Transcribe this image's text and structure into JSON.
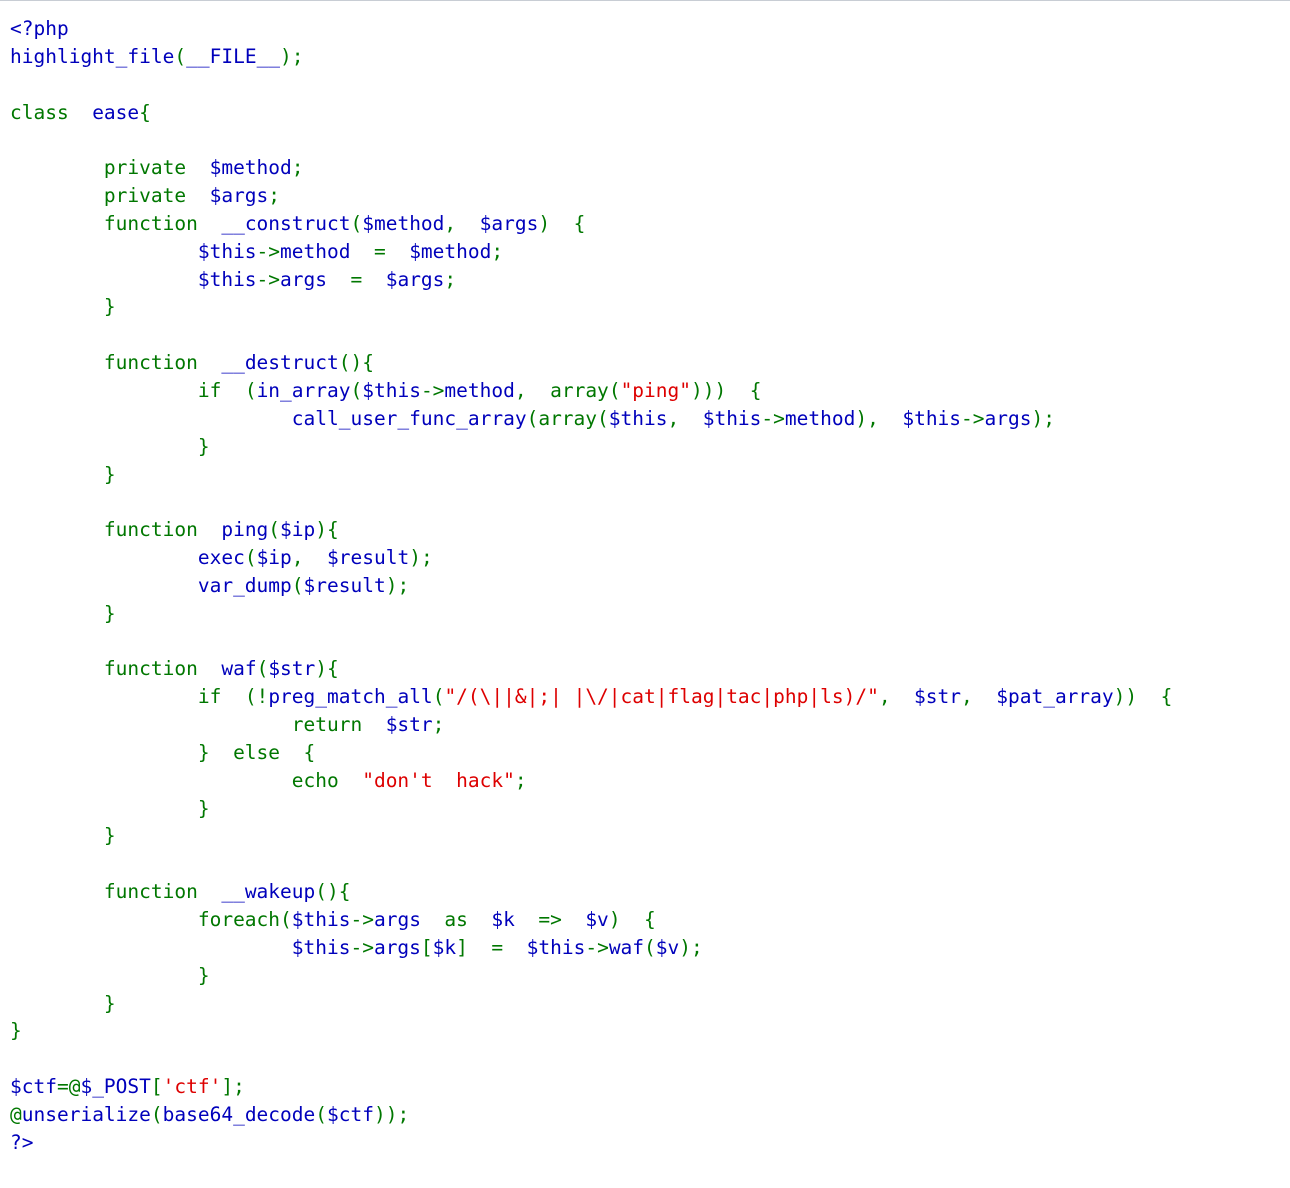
{
  "page": {
    "title": "highlight_file source view",
    "background": "#ffffff",
    "top_rule_color": "#c8cdd4"
  },
  "syntax_colors": {
    "keyword": "#007700",
    "default": "#0000BB",
    "string": "#DD0000",
    "comment": "#FF8000",
    "html": "#000000"
  },
  "code": {
    "language": "php",
    "lines": [
      [
        {
          "t": "<?php",
          "c": "def"
        }
      ],
      [
        {
          "t": "highlight_file",
          "c": "def"
        },
        {
          "t": "(",
          "c": "kw"
        },
        {
          "t": "__FILE__",
          "c": "def"
        },
        {
          "t": ")",
          "c": "kw"
        },
        {
          "t": ";",
          "c": "kw"
        }
      ],
      [],
      [
        {
          "t": "class ",
          "c": "kw"
        },
        {
          "t": " ease",
          "c": "def"
        },
        {
          "t": "{",
          "c": "kw"
        }
      ],
      [],
      [
        {
          "t": "        ",
          "c": "def"
        },
        {
          "t": "private ",
          "c": "kw"
        },
        {
          "t": " $method",
          "c": "def"
        },
        {
          "t": ";",
          "c": "kw"
        }
      ],
      [
        {
          "t": "        ",
          "c": "def"
        },
        {
          "t": "private ",
          "c": "kw"
        },
        {
          "t": " $args",
          "c": "def"
        },
        {
          "t": ";",
          "c": "kw"
        }
      ],
      [
        {
          "t": "        ",
          "c": "def"
        },
        {
          "t": "function ",
          "c": "kw"
        },
        {
          "t": " __construct",
          "c": "def"
        },
        {
          "t": "(",
          "c": "kw"
        },
        {
          "t": "$method",
          "c": "def"
        },
        {
          "t": ", ",
          "c": "kw"
        },
        {
          "t": " $args",
          "c": "def"
        },
        {
          "t": ") ",
          "c": "kw"
        },
        {
          "t": " {",
          "c": "kw"
        }
      ],
      [
        {
          "t": "                ",
          "c": "def"
        },
        {
          "t": "$this",
          "c": "def"
        },
        {
          "t": "->",
          "c": "kw"
        },
        {
          "t": "method ",
          "c": "def"
        },
        {
          "t": " = ",
          "c": "kw"
        },
        {
          "t": " $method",
          "c": "def"
        },
        {
          "t": ";",
          "c": "kw"
        }
      ],
      [
        {
          "t": "                ",
          "c": "def"
        },
        {
          "t": "$this",
          "c": "def"
        },
        {
          "t": "->",
          "c": "kw"
        },
        {
          "t": "args ",
          "c": "def"
        },
        {
          "t": " = ",
          "c": "kw"
        },
        {
          "t": " $args",
          "c": "def"
        },
        {
          "t": ";",
          "c": "kw"
        }
      ],
      [
        {
          "t": "        ",
          "c": "def"
        },
        {
          "t": "}",
          "c": "kw"
        }
      ],
      [],
      [
        {
          "t": "        ",
          "c": "def"
        },
        {
          "t": "function ",
          "c": "kw"
        },
        {
          "t": " __destruct",
          "c": "def"
        },
        {
          "t": "(){",
          "c": "kw"
        }
      ],
      [
        {
          "t": "                ",
          "c": "def"
        },
        {
          "t": "if ",
          "c": "kw"
        },
        {
          "t": " (",
          "c": "kw"
        },
        {
          "t": "in_array",
          "c": "def"
        },
        {
          "t": "(",
          "c": "kw"
        },
        {
          "t": "$this",
          "c": "def"
        },
        {
          "t": "->",
          "c": "kw"
        },
        {
          "t": "method",
          "c": "def"
        },
        {
          "t": ", ",
          "c": "kw"
        },
        {
          "t": " array",
          "c": "kw"
        },
        {
          "t": "(",
          "c": "kw"
        },
        {
          "t": "\"ping\"",
          "c": "str"
        },
        {
          "t": "))) ",
          "c": "kw"
        },
        {
          "t": " {",
          "c": "kw"
        }
      ],
      [
        {
          "t": "                        ",
          "c": "def"
        },
        {
          "t": "call_user_func_array",
          "c": "def"
        },
        {
          "t": "(",
          "c": "kw"
        },
        {
          "t": "array",
          "c": "kw"
        },
        {
          "t": "(",
          "c": "kw"
        },
        {
          "t": "$this",
          "c": "def"
        },
        {
          "t": ", ",
          "c": "kw"
        },
        {
          "t": " $this",
          "c": "def"
        },
        {
          "t": "->",
          "c": "kw"
        },
        {
          "t": "method",
          "c": "def"
        },
        {
          "t": "), ",
          "c": "kw"
        },
        {
          "t": " $this",
          "c": "def"
        },
        {
          "t": "->",
          "c": "kw"
        },
        {
          "t": "args",
          "c": "def"
        },
        {
          "t": ");",
          "c": "kw"
        }
      ],
      [
        {
          "t": "                ",
          "c": "def"
        },
        {
          "t": "}",
          "c": "kw"
        }
      ],
      [
        {
          "t": "        ",
          "c": "def"
        },
        {
          "t": "}",
          "c": "kw"
        }
      ],
      [],
      [
        {
          "t": "        ",
          "c": "def"
        },
        {
          "t": "function ",
          "c": "kw"
        },
        {
          "t": " ping",
          "c": "def"
        },
        {
          "t": "(",
          "c": "kw"
        },
        {
          "t": "$ip",
          "c": "def"
        },
        {
          "t": "){",
          "c": "kw"
        }
      ],
      [
        {
          "t": "                ",
          "c": "def"
        },
        {
          "t": "exec",
          "c": "def"
        },
        {
          "t": "(",
          "c": "kw"
        },
        {
          "t": "$ip",
          "c": "def"
        },
        {
          "t": ", ",
          "c": "kw"
        },
        {
          "t": " $result",
          "c": "def"
        },
        {
          "t": ");",
          "c": "kw"
        }
      ],
      [
        {
          "t": "                ",
          "c": "def"
        },
        {
          "t": "var_dump",
          "c": "def"
        },
        {
          "t": "(",
          "c": "kw"
        },
        {
          "t": "$result",
          "c": "def"
        },
        {
          "t": ");",
          "c": "kw"
        }
      ],
      [
        {
          "t": "        ",
          "c": "def"
        },
        {
          "t": "}",
          "c": "kw"
        }
      ],
      [],
      [
        {
          "t": "        ",
          "c": "def"
        },
        {
          "t": "function ",
          "c": "kw"
        },
        {
          "t": " waf",
          "c": "def"
        },
        {
          "t": "(",
          "c": "kw"
        },
        {
          "t": "$str",
          "c": "def"
        },
        {
          "t": "){",
          "c": "kw"
        }
      ],
      [
        {
          "t": "                ",
          "c": "def"
        },
        {
          "t": "if ",
          "c": "kw"
        },
        {
          "t": " (!",
          "c": "kw"
        },
        {
          "t": "preg_match_all",
          "c": "def"
        },
        {
          "t": "(",
          "c": "kw"
        },
        {
          "t": "\"/(\\||&|;| |\\/|cat|flag|tac|php|ls)/\"",
          "c": "str"
        },
        {
          "t": ", ",
          "c": "kw"
        },
        {
          "t": " $str",
          "c": "def"
        },
        {
          "t": ", ",
          "c": "kw"
        },
        {
          "t": " $pat_array",
          "c": "def"
        },
        {
          "t": ")) ",
          "c": "kw"
        },
        {
          "t": " {",
          "c": "kw"
        }
      ],
      [
        {
          "t": "                        ",
          "c": "def"
        },
        {
          "t": "return ",
          "c": "kw"
        },
        {
          "t": " $str",
          "c": "def"
        },
        {
          "t": ";",
          "c": "kw"
        }
      ],
      [
        {
          "t": "                ",
          "c": "def"
        },
        {
          "t": "} ",
          "c": "kw"
        },
        {
          "t": " else ",
          "c": "kw"
        },
        {
          "t": " {",
          "c": "kw"
        }
      ],
      [
        {
          "t": "                        ",
          "c": "def"
        },
        {
          "t": "echo ",
          "c": "kw"
        },
        {
          "t": " \"don't  hack\"",
          "c": "str"
        },
        {
          "t": ";",
          "c": "kw"
        }
      ],
      [
        {
          "t": "                ",
          "c": "def"
        },
        {
          "t": "}",
          "c": "kw"
        }
      ],
      [
        {
          "t": "        ",
          "c": "def"
        },
        {
          "t": "}",
          "c": "kw"
        }
      ],
      [],
      [
        {
          "t": "        ",
          "c": "def"
        },
        {
          "t": "function ",
          "c": "kw"
        },
        {
          "t": " __wakeup",
          "c": "def"
        },
        {
          "t": "(){",
          "c": "kw"
        }
      ],
      [
        {
          "t": "                ",
          "c": "def"
        },
        {
          "t": "foreach",
          "c": "kw"
        },
        {
          "t": "(",
          "c": "kw"
        },
        {
          "t": "$this",
          "c": "def"
        },
        {
          "t": "->",
          "c": "kw"
        },
        {
          "t": "args ",
          "c": "def"
        },
        {
          "t": " as ",
          "c": "kw"
        },
        {
          "t": " $k ",
          "c": "def"
        },
        {
          "t": " => ",
          "c": "kw"
        },
        {
          "t": " $v",
          "c": "def"
        },
        {
          "t": ") ",
          "c": "kw"
        },
        {
          "t": " {",
          "c": "kw"
        }
      ],
      [
        {
          "t": "                        ",
          "c": "def"
        },
        {
          "t": "$this",
          "c": "def"
        },
        {
          "t": "->",
          "c": "kw"
        },
        {
          "t": "args",
          "c": "def"
        },
        {
          "t": "[",
          "c": "kw"
        },
        {
          "t": "$k",
          "c": "def"
        },
        {
          "t": "] ",
          "c": "kw"
        },
        {
          "t": " = ",
          "c": "kw"
        },
        {
          "t": " $this",
          "c": "def"
        },
        {
          "t": "->",
          "c": "kw"
        },
        {
          "t": "waf",
          "c": "def"
        },
        {
          "t": "(",
          "c": "kw"
        },
        {
          "t": "$v",
          "c": "def"
        },
        {
          "t": ");",
          "c": "kw"
        }
      ],
      [
        {
          "t": "                ",
          "c": "def"
        },
        {
          "t": "}",
          "c": "kw"
        }
      ],
      [
        {
          "t": "        ",
          "c": "def"
        },
        {
          "t": "}",
          "c": "kw"
        }
      ],
      [
        {
          "t": "}",
          "c": "kw"
        }
      ],
      [],
      [
        {
          "t": "$ctf",
          "c": "def"
        },
        {
          "t": "=@",
          "c": "kw"
        },
        {
          "t": "$_POST",
          "c": "def"
        },
        {
          "t": "[",
          "c": "kw"
        },
        {
          "t": "'ctf'",
          "c": "str"
        },
        {
          "t": "];",
          "c": "kw"
        }
      ],
      [
        {
          "t": "@",
          "c": "kw"
        },
        {
          "t": "unserialize",
          "c": "def"
        },
        {
          "t": "(",
          "c": "kw"
        },
        {
          "t": "base64_decode",
          "c": "def"
        },
        {
          "t": "(",
          "c": "kw"
        },
        {
          "t": "$ctf",
          "c": "def"
        },
        {
          "t": "));",
          "c": "kw"
        }
      ],
      [
        {
          "t": "?>",
          "c": "def"
        }
      ]
    ],
    "plain_text": "<?php\nhighlight_file(__FILE__);\n\nclass  ease{\n\n        private  $method;\n        private  $args;\n        function  __construct($method,  $args)  {\n                $this->method  =  $method;\n                $this->args  =  $args;\n        }\n\n        function  __destruct(){\n                if  (in_array($this->method,  array(\"ping\")))  {\n                        call_user_func_array(array($this,  $this->method),  $this->args);\n                }\n        }\n\n        function  ping($ip){\n                exec($ip,  $result);\n                var_dump($result);\n        }\n\n        function  waf($str){\n                if  (!preg_match_all(\"/(\\||&|;| |\\/|cat|flag|tac|php|ls)/\",  $str,  $pat_array))  {\n                        return  $str;\n                }  else  {\n                        echo  \"don't  hack\";\n                }\n        }\n\n        function  __wakeup(){\n                foreach($this->args  as  $k  =>  $v)  {\n                        $this->args[$k]  =  $this->waf($v);\n                }\n        }\n}\n\n$ctf=@$_POST['ctf'];\n@unserialize(base64_decode($ctf));\n?>"
  }
}
